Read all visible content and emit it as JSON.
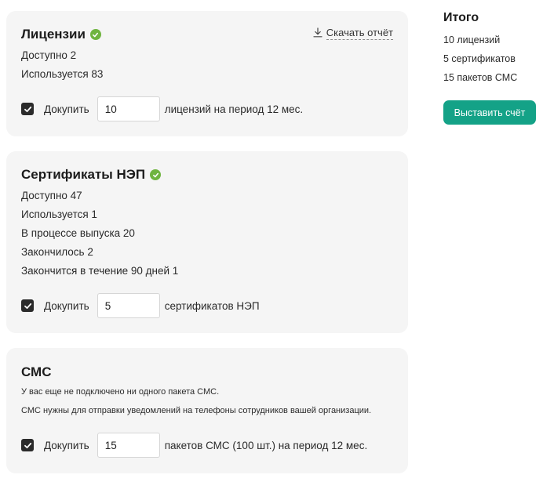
{
  "licenses": {
    "title": "Лицензии",
    "download_label": "Скачать отчёт",
    "available": "Доступно 2",
    "used": "Используется 83",
    "buy_label": "Докупить",
    "quantity": "10",
    "suffix": "лицензий на период 12 мес.",
    "checked": true
  },
  "certificates": {
    "title": "Сертификаты НЭП",
    "available": "Доступно 47",
    "used": "Используется 1",
    "in_progress": "В процессе выпуска 20",
    "expired": "Закончилось 2",
    "expiring": "Закончится в течение 90 дней 1",
    "buy_label": "Докупить",
    "quantity": "5",
    "suffix": "сертификатов НЭП",
    "checked": true
  },
  "sms": {
    "title": "СМС",
    "note1": "У вас еще не подключено ни одного пакета СМС.",
    "note2": "СМС нужны для отправки уведомлений на телефоны сотрудников вашей организации.",
    "buy_label": "Докупить",
    "quantity": "15",
    "suffix": "пакетов СМС (100 шт.) на период 12 мес.",
    "checked": true
  },
  "summary": {
    "title": "Итого",
    "lines": [
      "10 лицензий",
      "5 сертификатов",
      "15 пакетов СМС"
    ],
    "button_label": "Выставить счёт"
  },
  "icons": {
    "ok": "check-circle-icon",
    "checkbox": "checkmark-icon",
    "download": "download-icon"
  },
  "colors": {
    "accent": "#14a287",
    "ok_green": "#6fb43f",
    "card_bg": "#f5f5f5",
    "checkbox_bg": "#2b2b2b"
  }
}
